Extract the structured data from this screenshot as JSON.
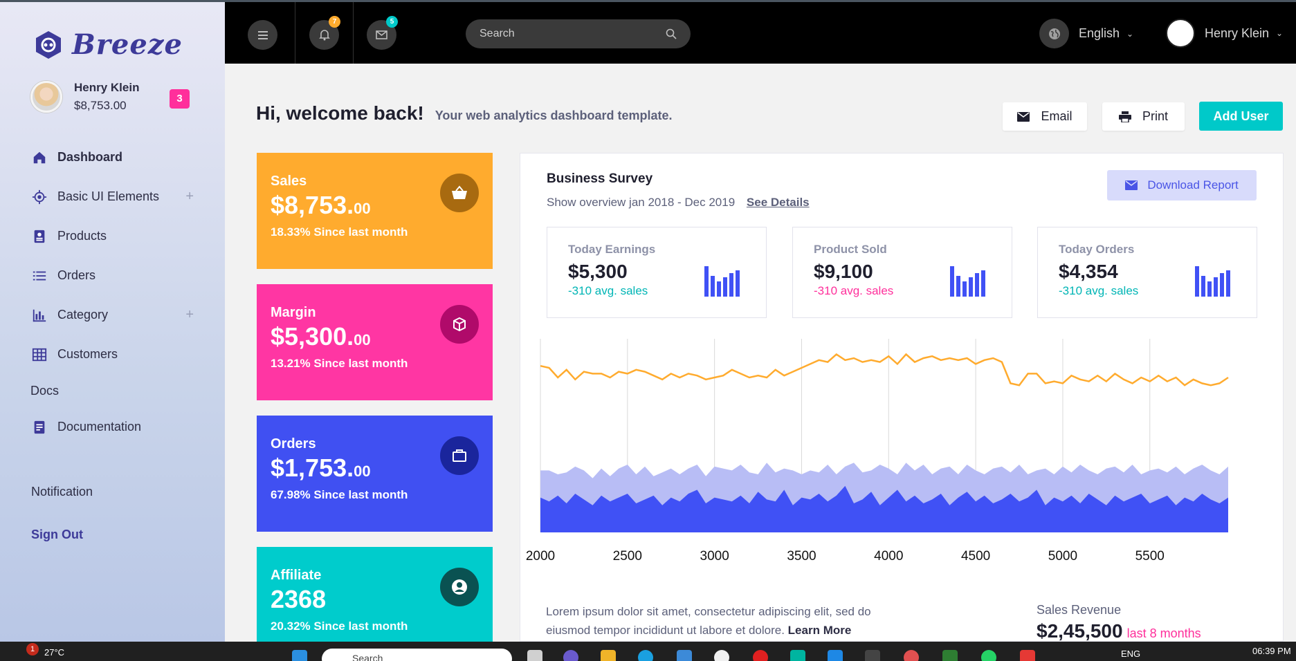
{
  "brand": {
    "name": "Breeze"
  },
  "profile": {
    "name": "Henry Klein",
    "amount": "$8,753.00",
    "badge": "3"
  },
  "sidebar": {
    "items": [
      {
        "label": "Dashboard",
        "icon": "home-icon"
      },
      {
        "label": "Basic UI Elements",
        "icon": "crosshair-icon",
        "expand": "+"
      },
      {
        "label": "Products",
        "icon": "contact-card-icon"
      },
      {
        "label": "Orders",
        "icon": "list-icon"
      },
      {
        "label": "Category",
        "icon": "bar-chart-icon",
        "expand": "+"
      },
      {
        "label": "Customers",
        "icon": "grid-icon"
      }
    ],
    "section": "Docs",
    "docs": [
      {
        "label": "Documentation",
        "icon": "document-icon"
      }
    ],
    "notification": "Notification",
    "signout": "Sign Out"
  },
  "topbar": {
    "notifications_count": "7",
    "messages_count": "5",
    "search_placeholder": "Search",
    "language": "English",
    "user_name": "Henry Klein"
  },
  "header": {
    "title": "Hi, welcome back!",
    "subtitle": "Your web analytics dashboard template.",
    "email_label": "Email",
    "print_label": "Print",
    "add_user_label": "Add User"
  },
  "stats": [
    {
      "label": "Sales",
      "value": "$8,753.",
      "cents": "00",
      "change": "18.33% Since last month",
      "color": "#ffab2e",
      "icon": "basket-icon"
    },
    {
      "label": "Margin",
      "value": "$5,300.",
      "cents": "00",
      "change": "13.21% Since last month",
      "color": "#ff36a3",
      "icon": "cube-icon"
    },
    {
      "label": "Orders",
      "value": "$1,753.",
      "cents": "00",
      "change": "67.98% Since last month",
      "color": "#4050f2",
      "icon": "briefcase-icon"
    },
    {
      "label": "Affiliate",
      "value": "2368",
      "cents": "",
      "change": "20.32% Since last month",
      "color": "#00cccc",
      "icon": "user-circle-icon"
    }
  ],
  "survey": {
    "title": "Business Survey",
    "subtitle": "Show overview jan 2018 - Dec 2019",
    "details_link": "See Details",
    "download_label": "Download Report",
    "minis": [
      {
        "label": "Today Earnings",
        "value": "$5,300",
        "sub": "-310 avg. sales",
        "sub_color": "#00b5b5"
      },
      {
        "label": "Product Sold",
        "value": "$9,100",
        "sub": "-310 avg. sales",
        "sub_color": "#ff2f9b"
      },
      {
        "label": "Today Orders",
        "value": "$4,354",
        "sub": "-310 avg. sales",
        "sub_color": "#00b5b5"
      }
    ],
    "lorem": "Lorem ipsum dolor sit amet, consectetur adipiscing elit, sed do eiusmod tempor incididunt ut labore et dolore.",
    "learn_more": "Learn More",
    "revenue_label": "Sales Revenue",
    "revenue_value": "$2,45,500",
    "revenue_period": "last 8 months"
  },
  "chart_data": {
    "type": "area",
    "x": [
      2000,
      2050,
      2100,
      2150,
      2200,
      2250,
      2300,
      2350,
      2400,
      2450,
      2500,
      2550,
      2600,
      2650,
      2700,
      2750,
      2800,
      2850,
      2900,
      2950,
      3000,
      3050,
      3100,
      3150,
      3200,
      3250,
      3300,
      3350,
      3400,
      3450,
      3500,
      3550,
      3600,
      3650,
      3700,
      3750,
      3800,
      3850,
      3900,
      3950,
      4000,
      4050,
      4100,
      4150,
      4200,
      4250,
      4300,
      4350,
      4400,
      4450,
      4500,
      4550,
      4600,
      4650,
      4700,
      4750,
      4800,
      4850,
      4900,
      4950,
      5000,
      5050,
      5100,
      5150,
      5200,
      5250,
      5300,
      5350,
      5400,
      5450,
      5500,
      5550,
      5600,
      5650,
      5700,
      5750,
      5800,
      5850,
      5900,
      5950
    ],
    "xticks": [
      2000,
      2500,
      3000,
      3500,
      4000,
      4500,
      5000,
      5500
    ],
    "xlim": [
      2000,
      5950
    ],
    "ylim": [
      0,
      100
    ],
    "series": [
      {
        "color": "#ffab2e",
        "values": [
          86,
          85,
          80,
          84,
          79,
          83,
          82,
          82,
          80,
          83,
          82,
          84,
          83,
          81,
          79,
          82,
          80,
          82,
          81,
          79,
          80,
          81,
          84,
          82,
          80,
          81,
          80,
          84,
          81,
          83,
          85,
          87,
          89,
          88,
          92,
          89,
          90,
          88,
          89,
          88,
          91,
          87,
          92,
          88,
          90,
          91,
          89,
          90,
          89,
          90,
          87,
          89,
          90,
          88,
          77,
          76,
          82,
          82,
          77,
          78,
          77,
          81,
          79,
          78,
          81,
          78,
          82,
          79,
          77,
          80,
          78,
          81,
          78,
          80,
          76,
          79,
          77,
          76,
          77,
          80
        ]
      },
      {
        "color": "#b8bdf5",
        "values": [
          32,
          32,
          30,
          31,
          34,
          32,
          28,
          33,
          29,
          33,
          35,
          30,
          34,
          29,
          31,
          33,
          30,
          33,
          35,
          29,
          34,
          33,
          32,
          35,
          31,
          30,
          36,
          31,
          33,
          32,
          30,
          32,
          31,
          35,
          30,
          34,
          36,
          31,
          32,
          35,
          33,
          30,
          36,
          32,
          35,
          30,
          33,
          34,
          30,
          35,
          32,
          30,
          33,
          34,
          31,
          35,
          30,
          32,
          33,
          30,
          34,
          31,
          35,
          32,
          30,
          33,
          34,
          31,
          35,
          30,
          32,
          33,
          31,
          34,
          30,
          33,
          35,
          32,
          30,
          34
        ]
      },
      {
        "color": "#4051f5",
        "values": [
          18,
          16,
          19,
          15,
          20,
          17,
          14,
          19,
          16,
          18,
          20,
          15,
          17,
          19,
          14,
          18,
          16,
          20,
          22,
          15,
          18,
          17,
          16,
          19,
          15,
          21,
          17,
          16,
          22,
          14,
          18,
          17,
          20,
          16,
          19,
          24,
          15,
          17,
          21,
          14,
          18,
          22,
          16,
          19,
          15,
          17,
          20,
          14,
          18,
          21,
          16,
          19,
          15,
          17,
          20,
          16,
          18,
          22,
          14,
          18,
          16,
          19,
          15,
          20,
          17,
          14,
          19,
          16,
          18,
          20,
          15,
          17,
          19,
          14,
          18,
          16,
          20,
          17,
          15,
          18
        ]
      }
    ]
  },
  "taskbar": {
    "weather_alerts": "1",
    "weather": "27°C",
    "search": "Search",
    "lang": "ENG",
    "time": "06:39 PM"
  },
  "colors": {
    "accent": "#4051f5",
    "teal": "#00c9c9",
    "pink": "#ff2f9b",
    "orange": "#ffab2e",
    "brand": "#3d3a99"
  }
}
